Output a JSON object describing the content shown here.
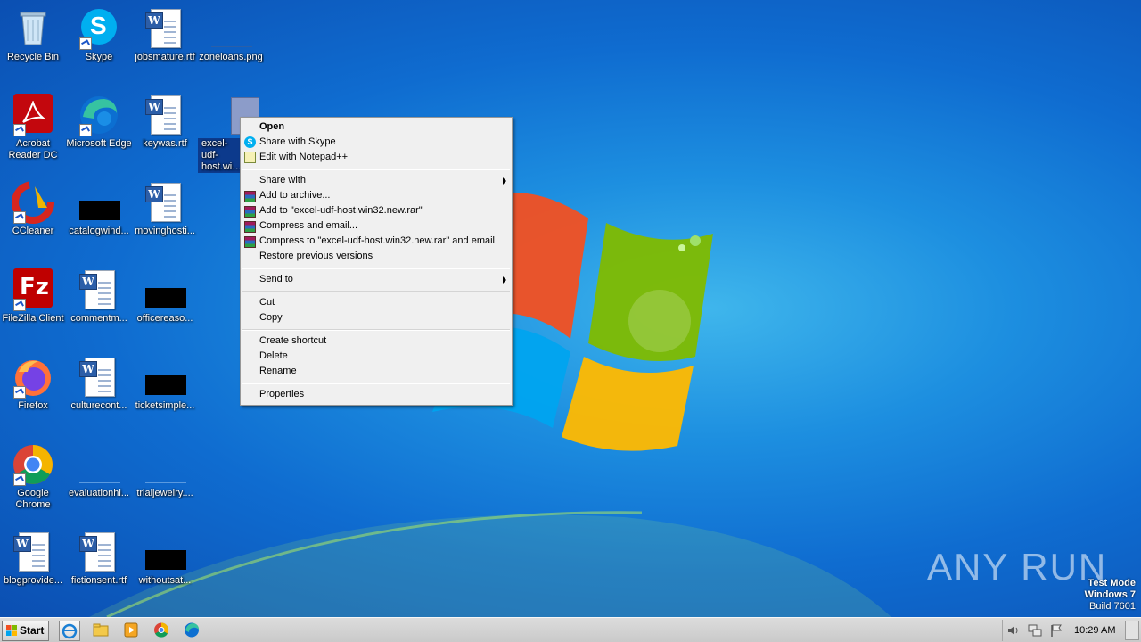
{
  "desktop": {
    "icons": [
      {
        "label": "Recycle Bin"
      },
      {
        "label": "Skype"
      },
      {
        "label": "jobsmature.rtf"
      },
      {
        "label": "zoneloans.png"
      },
      {
        "label": "Acrobat Reader DC"
      },
      {
        "label": "Microsoft Edge"
      },
      {
        "label": "keywas.rtf"
      },
      {
        "label": "excel-udf-host.win32.new.rar"
      },
      {
        "label": "CCleaner"
      },
      {
        "label": "catalogwind..."
      },
      {
        "label": "movinghosti..."
      },
      {
        "label": "FileZilla Client"
      },
      {
        "label": "commentm..."
      },
      {
        "label": "officereaso..."
      },
      {
        "label": "Firefox"
      },
      {
        "label": "culturecont..."
      },
      {
        "label": "ticketsimple..."
      },
      {
        "label": "Google Chrome"
      },
      {
        "label": "evaluationhi..."
      },
      {
        "label": "trialjewelry...."
      },
      {
        "label": "blogprovide..."
      },
      {
        "label": "fictionsent.rtf"
      },
      {
        "label": "withoutsat..."
      }
    ]
  },
  "context_menu": {
    "items": [
      {
        "label": "Open"
      },
      {
        "label": "Share with Skype",
        "icon": "skype-icon"
      },
      {
        "label": "Edit with Notepad++",
        "icon": "notepadpp-icon"
      },
      {
        "label": "Share with"
      },
      {
        "label": "Add to archive...",
        "icon": "winrar-icon"
      },
      {
        "label": "Add to \"excel-udf-host.win32.new.rar\"",
        "icon": "winrar-icon"
      },
      {
        "label": "Compress and email...",
        "icon": "winrar-icon"
      },
      {
        "label": "Compress to \"excel-udf-host.win32.new.rar\" and email",
        "icon": "winrar-icon"
      },
      {
        "label": "Restore previous versions"
      },
      {
        "label": "Send to"
      },
      {
        "label": "Cut"
      },
      {
        "label": "Copy"
      },
      {
        "label": "Create shortcut"
      },
      {
        "label": "Delete"
      },
      {
        "label": "Rename"
      },
      {
        "label": "Properties"
      }
    ]
  },
  "taskbar": {
    "start_label": "Start",
    "clock": "10:29 AM"
  },
  "watermark": {
    "line1": "Test Mode",
    "line2": "Windows 7",
    "line3": "Build 7601",
    "brand": "ANY RUN"
  },
  "colors": {
    "desktop_bg": "#1d8fe0",
    "selection": "#0c3a8c",
    "menu_bg": "#f0f0f0",
    "taskbar_bg": "#d4d4d4"
  }
}
